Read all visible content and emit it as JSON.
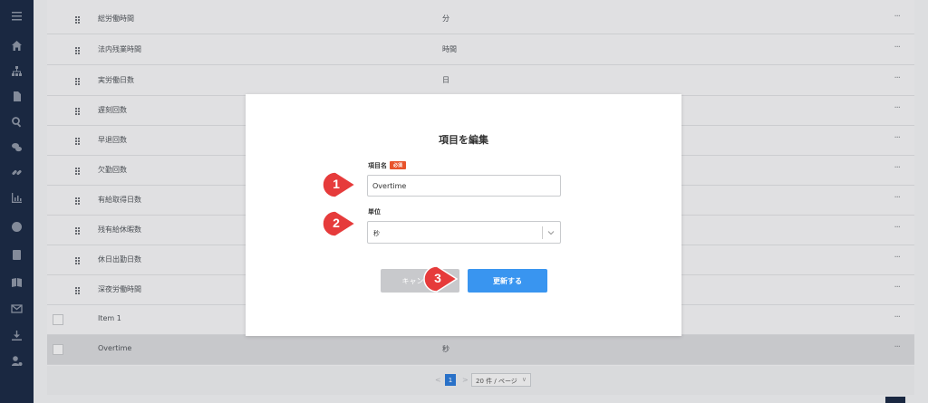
{
  "sidebar": {
    "icons": [
      "menu-icon",
      "home-icon",
      "org-chart-icon",
      "document-icon",
      "search-icon",
      "chat-icon",
      "link-icon",
      "chart-icon",
      "info-icon",
      "contact-card-icon",
      "book-icon",
      "mail-icon",
      "download-icon",
      "user-settings-icon"
    ]
  },
  "table": {
    "rows": [
      {
        "name": "総労働時間",
        "unit": "分",
        "more": "···"
      },
      {
        "name": "法内残業時間",
        "unit": "時間",
        "more": "···"
      },
      {
        "name": "実労働日数",
        "unit": "日",
        "more": "···"
      },
      {
        "name": "遅刻回数",
        "unit": "",
        "more": "···"
      },
      {
        "name": "早退回数",
        "unit": "",
        "more": "···"
      },
      {
        "name": "欠勤回数",
        "unit": "",
        "more": "···"
      },
      {
        "name": "有給取得日数",
        "unit": "",
        "more": "···"
      },
      {
        "name": "残有給休暇数",
        "unit": "",
        "more": "···"
      },
      {
        "name": "休日出勤日数",
        "unit": "",
        "more": "···"
      },
      {
        "name": "深夜労働時間",
        "unit": "",
        "more": "···"
      },
      {
        "name": "Item 1",
        "unit": "",
        "more": "···"
      },
      {
        "name": "Overtime",
        "unit": "秒",
        "more": "···"
      }
    ]
  },
  "pagination": {
    "prev": "<",
    "current": "1",
    "next": ">",
    "page_size": "20 件 / ページ",
    "page_size_chevron": "∨"
  },
  "dialog": {
    "title": "項目を編集",
    "name_label": "項目名",
    "required_badge": "必須",
    "name_value": "Overtime",
    "unit_label": "単位",
    "unit_value": "秒",
    "cancel_label": "キャンセル",
    "update_label": "更新する"
  },
  "markers": [
    "1",
    "2",
    "3"
  ],
  "colors": {
    "sidebar": "#1c2c46",
    "primary": "#3995f0",
    "required": "#e8532b",
    "marker": "#e63b3b"
  }
}
